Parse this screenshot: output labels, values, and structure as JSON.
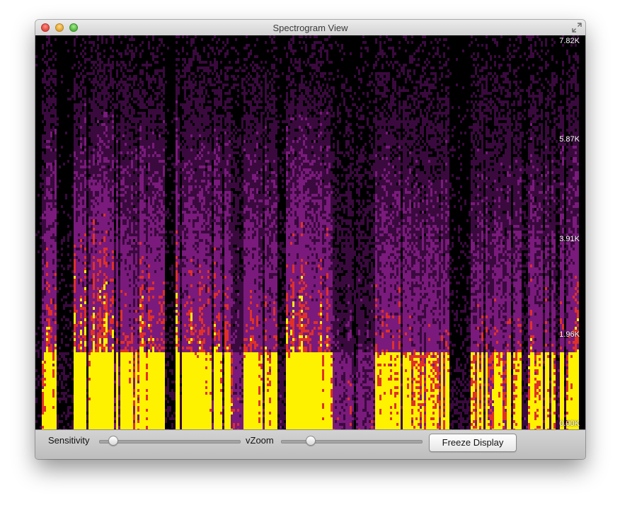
{
  "window": {
    "title": "Spectrogram View"
  },
  "spectrogram": {
    "frequency_labels": [
      "7.82K",
      "5.87K",
      "3.91K",
      "1.96K",
      "0.00K"
    ],
    "colors": {
      "background": "#000000",
      "low": "#3a0a3e",
      "mid": "#7a1a7c",
      "high": "#e0302a",
      "peak": "#fff200"
    }
  },
  "controls": {
    "sensitivity_label": "Sensitivity",
    "vzoom_label": "vZoom",
    "freeze_button_label": "Freeze Display",
    "sensitivity_value": 0.1,
    "vzoom_value": 0.21
  }
}
